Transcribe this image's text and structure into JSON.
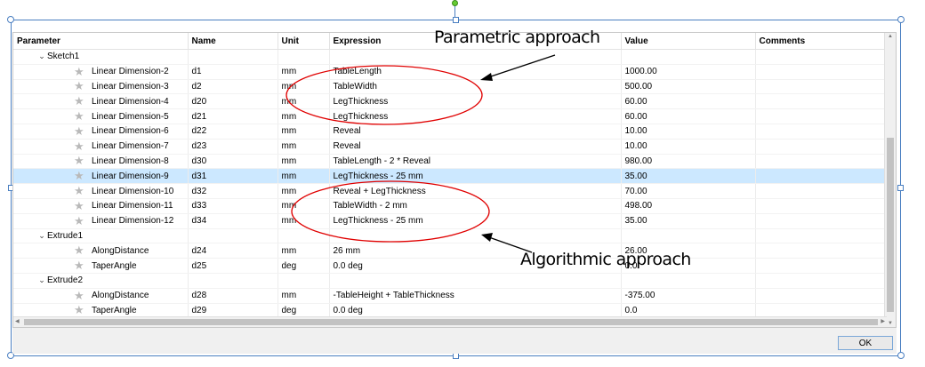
{
  "columns": {
    "parameter": "Parameter",
    "name": "Name",
    "unit": "Unit",
    "expression": "Expression",
    "value": "Value",
    "comments": "Comments"
  },
  "groups": [
    {
      "label": "Sketch1",
      "rows": [
        {
          "parameter": "Linear Dimension-2",
          "name": "d1",
          "unit": "mm",
          "expression": "TableLength",
          "value": "1000.00",
          "comments": ""
        },
        {
          "parameter": "Linear Dimension-3",
          "name": "d2",
          "unit": "mm",
          "expression": "TableWidth",
          "value": "500.00",
          "comments": ""
        },
        {
          "parameter": "Linear Dimension-4",
          "name": "d20",
          "unit": "mm",
          "expression": "LegThickness",
          "value": "60.00",
          "comments": ""
        },
        {
          "parameter": "Linear Dimension-5",
          "name": "d21",
          "unit": "mm",
          "expression": "LegThickness",
          "value": "60.00",
          "comments": ""
        },
        {
          "parameter": "Linear Dimension-6",
          "name": "d22",
          "unit": "mm",
          "expression": "Reveal",
          "value": "10.00",
          "comments": ""
        },
        {
          "parameter": "Linear Dimension-7",
          "name": "d23",
          "unit": "mm",
          "expression": "Reveal",
          "value": "10.00",
          "comments": ""
        },
        {
          "parameter": "Linear Dimension-8",
          "name": "d30",
          "unit": "mm",
          "expression": "TableLength - 2 * Reveal",
          "value": "980.00",
          "comments": ""
        },
        {
          "parameter": "Linear Dimension-9",
          "name": "d31",
          "unit": "mm",
          "expression": "LegThickness - 25 mm",
          "value": "35.00",
          "comments": "",
          "selected": true
        },
        {
          "parameter": "Linear Dimension-10",
          "name": "d32",
          "unit": "mm",
          "expression": "Reveal + LegThickness",
          "value": "70.00",
          "comments": ""
        },
        {
          "parameter": "Linear Dimension-11",
          "name": "d33",
          "unit": "mm",
          "expression": "TableWidth - 2 mm",
          "value": "498.00",
          "comments": ""
        },
        {
          "parameter": "Linear Dimension-12",
          "name": "d34",
          "unit": "mm",
          "expression": "LegThickness - 25 mm",
          "value": "35.00",
          "comments": ""
        }
      ]
    },
    {
      "label": "Extrude1",
      "rows": [
        {
          "parameter": "AlongDistance",
          "name": "d24",
          "unit": "mm",
          "expression": "26 mm",
          "value": "26.00",
          "comments": ""
        },
        {
          "parameter": "TaperAngle",
          "name": "d25",
          "unit": "deg",
          "expression": "0.0 deg",
          "value": "0.0",
          "comments": ""
        }
      ]
    },
    {
      "label": "Extrude2",
      "rows": [
        {
          "parameter": "AlongDistance",
          "name": "d28",
          "unit": "mm",
          "expression": "-TableHeight + TableThickness",
          "value": "-375.00",
          "comments": ""
        },
        {
          "parameter": "TaperAngle",
          "name": "d29",
          "unit": "deg",
          "expression": "0.0 deg",
          "value": "0.0",
          "comments": ""
        }
      ]
    }
  ],
  "ok_label": "OK",
  "annotations": {
    "parametric": "Parametric approach",
    "algorithmic": "Algorithmic approach"
  },
  "icons": {
    "expand": "chevron-down-icon",
    "parameter": "star-icon"
  },
  "colors": {
    "selection": "#cce8ff",
    "annotation_ellipse": "#e00000",
    "frame": "#4a7fc1",
    "rotation_handle": "#66cc33"
  }
}
